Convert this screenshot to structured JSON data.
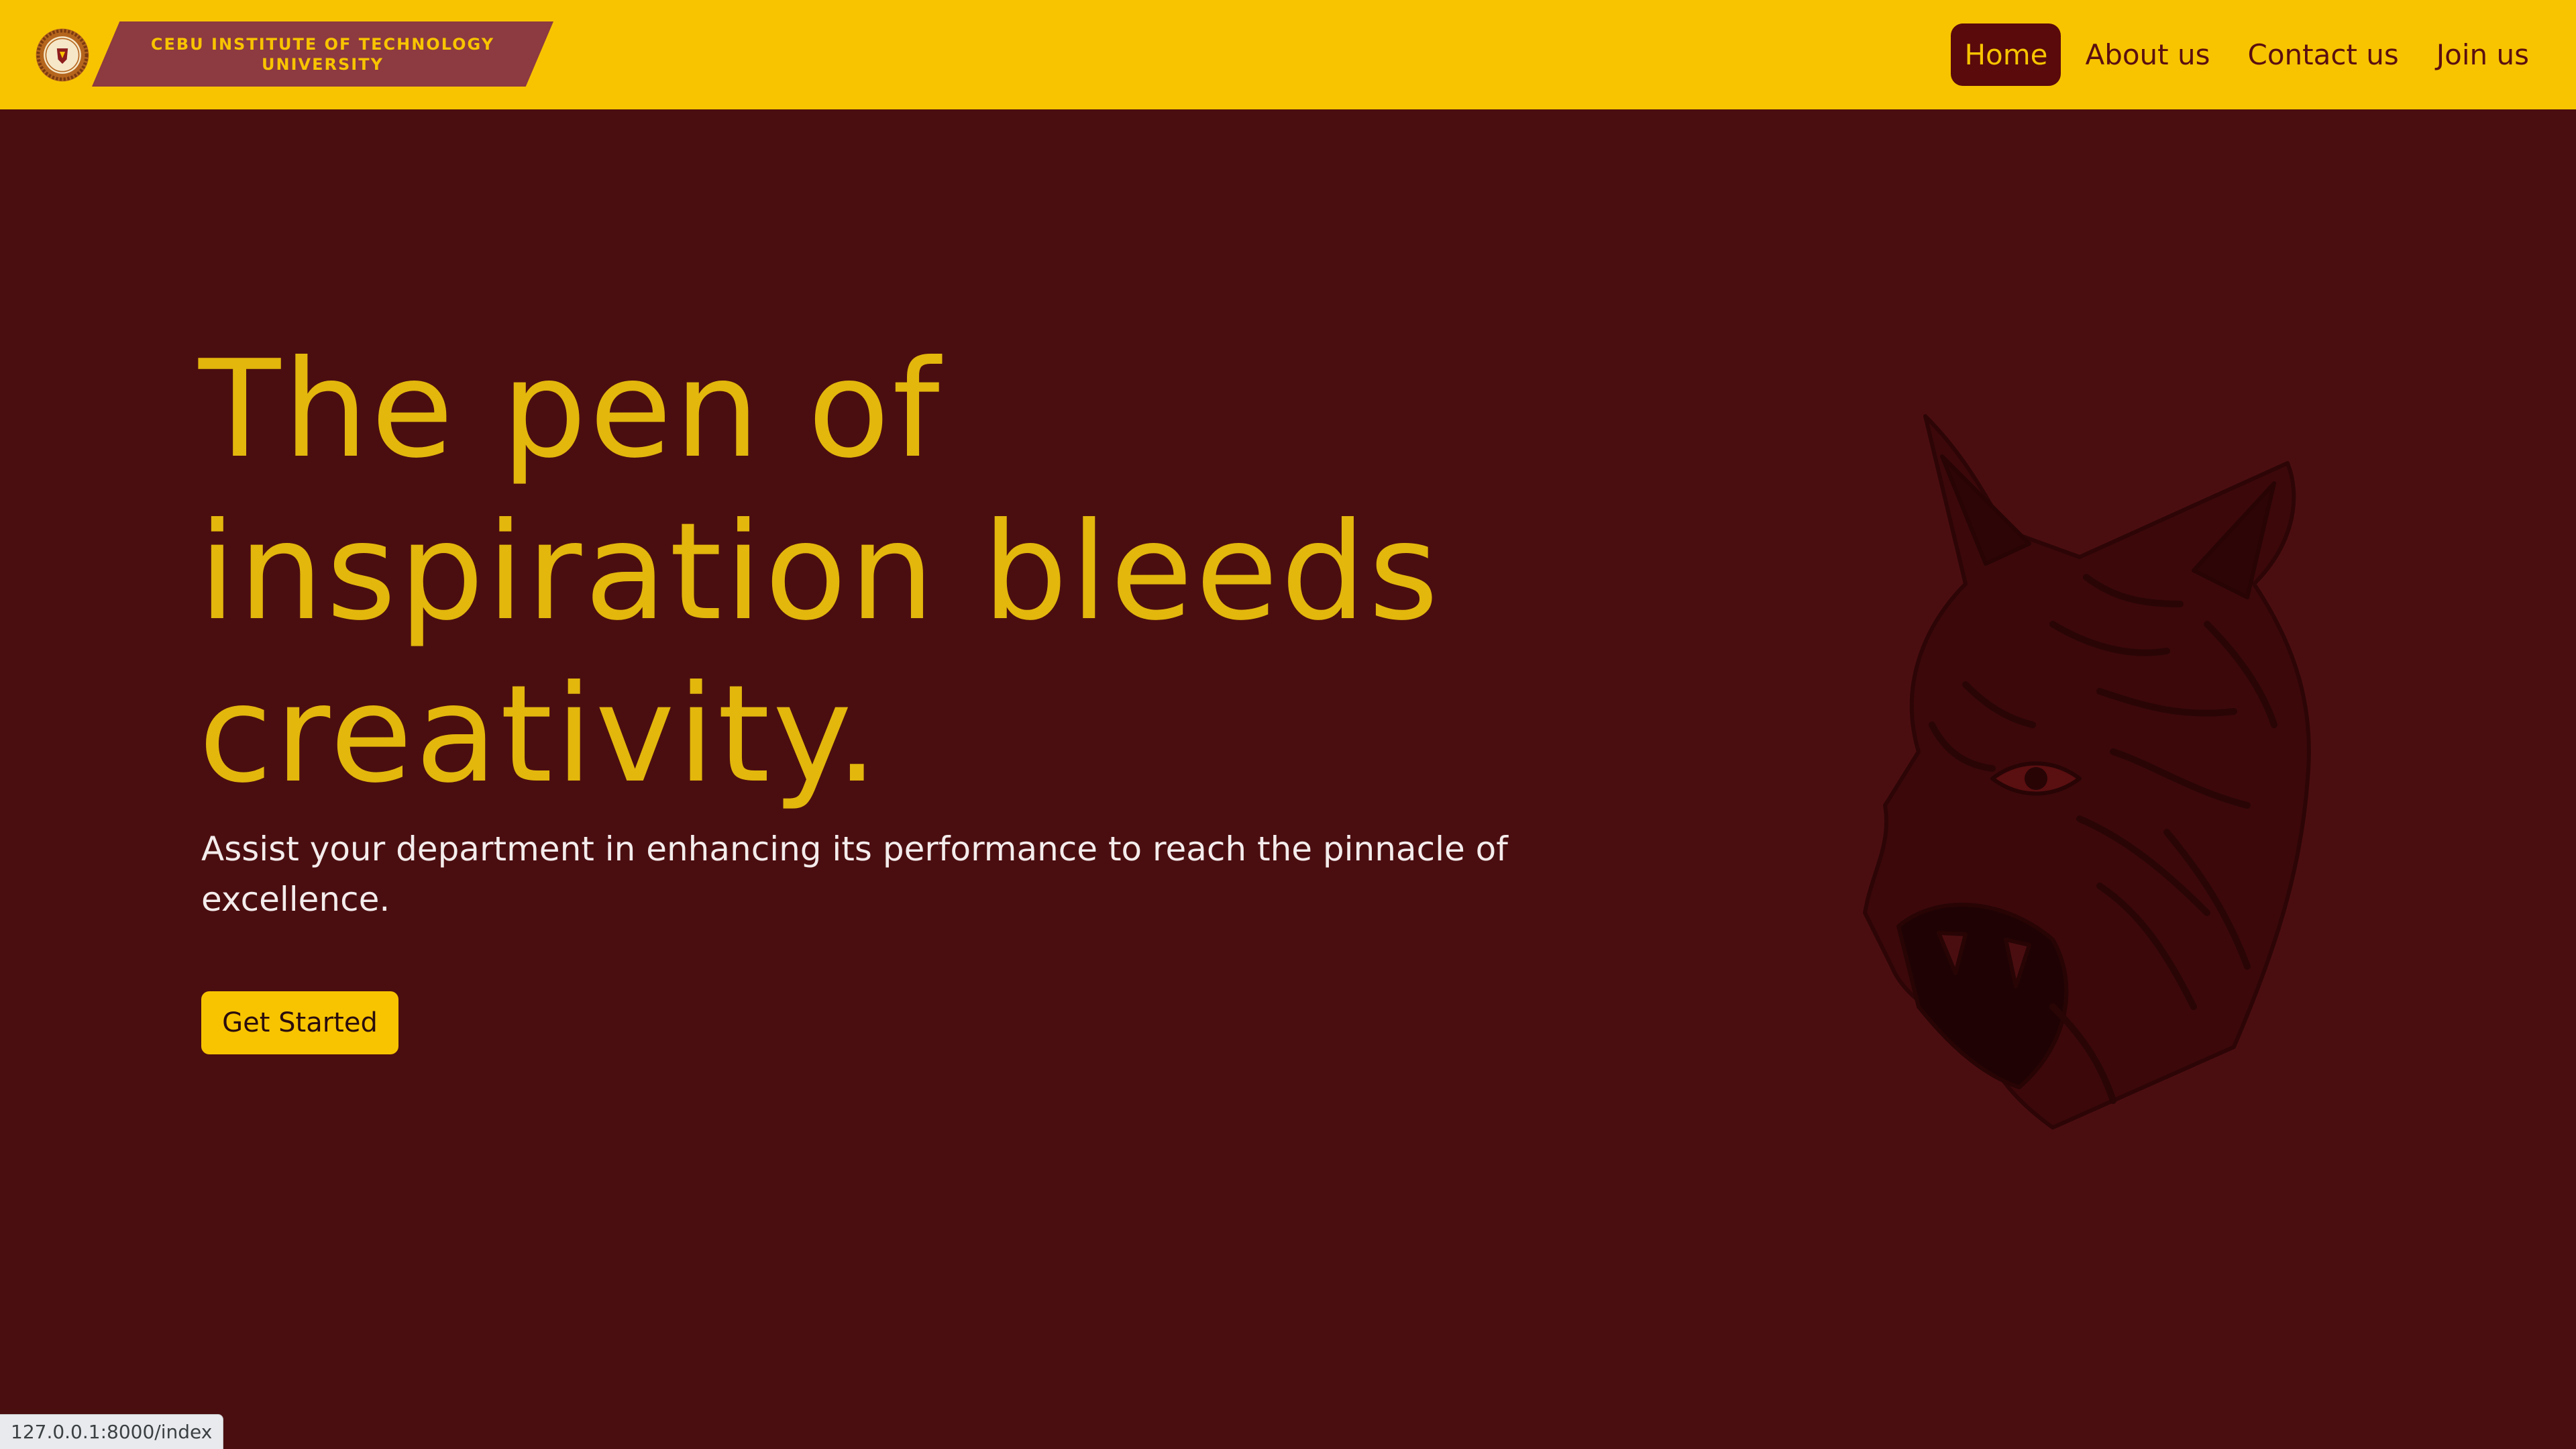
{
  "header": {
    "brand_line1": "CEBU INSTITUTE OF TECHNOLOGY",
    "brand_line2": "UNIVERSITY",
    "nav": [
      {
        "label": "Home",
        "active": true
      },
      {
        "label": "About us",
        "active": false
      },
      {
        "label": "Contact us",
        "active": false
      },
      {
        "label": "Join us",
        "active": false
      }
    ]
  },
  "hero": {
    "title_line1": "The pen of",
    "title_line2": "inspiration bleeds",
    "title_line3": "creativity.",
    "subtitle_line1": "Assist your department in enhancing its performance to reach the pinnacle of",
    "subtitle_line2": "excellence.",
    "cta_label": "Get Started"
  },
  "status": {
    "url": "127.0.0.1:8000/index"
  },
  "colors": {
    "primary_yellow": "#f8c400",
    "maroon_bg": "#4b0e10",
    "banner_red": "#8d3a40",
    "title_gold": "#e3b70c"
  },
  "icons": {
    "logo": "university-seal-icon",
    "mascot": "wildcat-mascot-icon"
  }
}
